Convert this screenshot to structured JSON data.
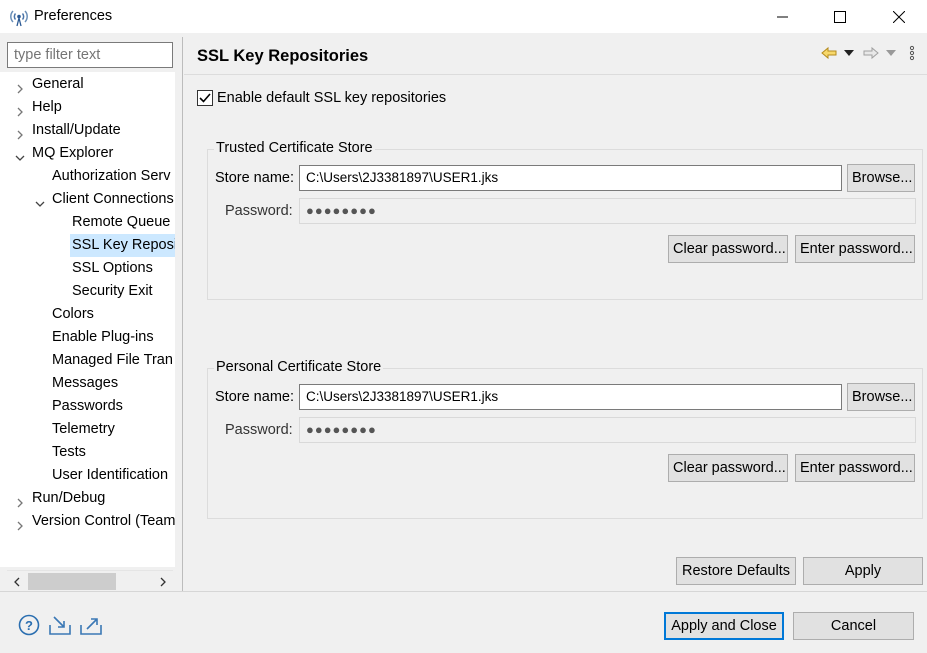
{
  "window": {
    "title": "Preferences",
    "app_icon": "antenna-icon",
    "controls": [
      "minimize-icon",
      "maximize-icon",
      "close-icon"
    ]
  },
  "filter": {
    "placeholder": "type filter text"
  },
  "tree": {
    "items": [
      {
        "label": "General",
        "level": 0,
        "expander": "collapsed"
      },
      {
        "label": "Help",
        "level": 0,
        "expander": "collapsed"
      },
      {
        "label": "Install/Update",
        "level": 0,
        "expander": "collapsed"
      },
      {
        "label": "MQ Explorer",
        "level": 0,
        "expander": "expanded"
      },
      {
        "label": "Authorization Serv",
        "level": 1,
        "expander": "none"
      },
      {
        "label": "Client Connections",
        "level": 1,
        "expander": "expanded"
      },
      {
        "label": "Remote Queue",
        "level": 2,
        "expander": "none"
      },
      {
        "label": "SSL Key Reposi",
        "level": 2,
        "expander": "none",
        "selected": true
      },
      {
        "label": "SSL Options",
        "level": 2,
        "expander": "none"
      },
      {
        "label": "Security Exit",
        "level": 2,
        "expander": "none"
      },
      {
        "label": "Colors",
        "level": 1,
        "expander": "none"
      },
      {
        "label": "Enable Plug-ins",
        "level": 1,
        "expander": "none"
      },
      {
        "label": "Managed File Tran",
        "level": 1,
        "expander": "none"
      },
      {
        "label": "Messages",
        "level": 1,
        "expander": "none"
      },
      {
        "label": "Passwords",
        "level": 1,
        "expander": "none"
      },
      {
        "label": "Telemetry",
        "level": 1,
        "expander": "none"
      },
      {
        "label": "Tests",
        "level": 1,
        "expander": "none"
      },
      {
        "label": "User Identification",
        "level": 1,
        "expander": "none"
      },
      {
        "label": "Run/Debug",
        "level": 0,
        "expander": "collapsed"
      },
      {
        "label": "Version Control (Team",
        "level": 0,
        "expander": "collapsed"
      }
    ]
  },
  "page": {
    "title": "SSL Key Repositories",
    "nav_icons": [
      "back-arrow-icon",
      "back-dropdown-icon",
      "forward-arrow-icon",
      "forward-dropdown-icon",
      "view-menu-icon"
    ],
    "enable_default": {
      "label": "Enable default SSL key repositories",
      "checked": true
    },
    "trusted": {
      "title": "Trusted Certificate Store",
      "store_label": "Store name:",
      "store_value": "C:\\Users\\2J3381897\\USER1.jks",
      "browse": "Browse...",
      "password_label": "Password:",
      "password_value": "●●●●●●●●",
      "clear": "Clear password...",
      "enter": "Enter password..."
    },
    "personal": {
      "title": "Personal Certificate Store",
      "store_label": "Store name:",
      "store_value": "C:\\Users\\2J3381897\\USER1.jks",
      "browse": "Browse...",
      "password_label": "Password:",
      "password_value": "●●●●●●●●",
      "clear": "Clear password...",
      "enter": "Enter password..."
    },
    "restore_defaults": "Restore Defaults",
    "apply": "Apply"
  },
  "footer": {
    "icons": [
      "help-icon",
      "import-icon",
      "export-icon"
    ],
    "apply_close": "Apply and Close",
    "cancel": "Cancel"
  },
  "colors": {
    "selection": "#cce8ff",
    "default_button_border": "#0078d7"
  }
}
